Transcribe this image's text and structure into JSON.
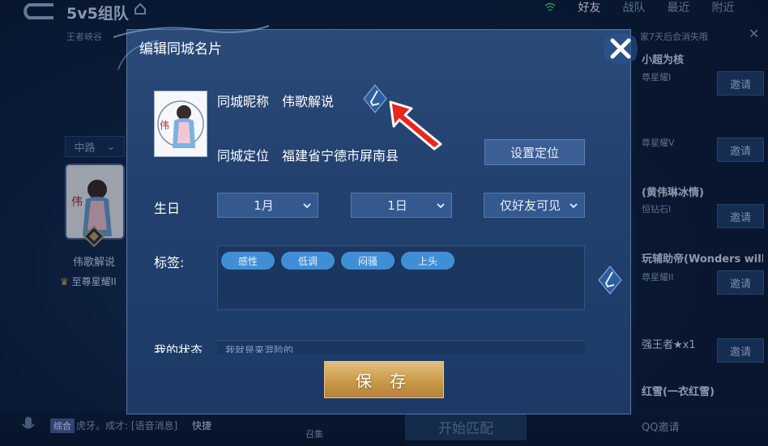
{
  "lobby": {
    "title": "5v5组队",
    "subtitle": "王者峡谷",
    "tabs": [
      "好友",
      "战队",
      "最近",
      "附近"
    ],
    "active_tab": "好友",
    "side_hint": "家7天后会消失哦",
    "friends": [
      {
        "name": "小超为核",
        "rank": "尊星耀I",
        "invite": "邀请"
      },
      {
        "name": "",
        "rank": "尊星耀V",
        "invite": "邀请"
      },
      {
        "name": "(黄伟琳冰情)",
        "rank": "恒钻石I",
        "invite": "邀请"
      },
      {
        "name": "玩辅助帝(Wonders will",
        "rank": "尊星耀II",
        "invite": "邀请"
      },
      {
        "name": "强王者★x1",
        "rank": "",
        "invite": "邀请"
      },
      {
        "name": "红雪(一衣红雪)",
        "rank": "",
        "invite": ""
      }
    ],
    "lane": "中路",
    "hero_name": "伟歌解说",
    "hero_rank": "至尊星耀II",
    "chat_tag": "综合",
    "chat_text": "虎牙。成才: [语音消息]",
    "quick": "快捷",
    "recruit": "召集",
    "start_match": "开始匹配",
    "qq_invite": "QQ邀请"
  },
  "modal": {
    "title": "编辑同城名片",
    "nickname_label": "同城昵称",
    "nickname_value": "伟歌解说",
    "location_label": "同城定位",
    "location_value": "福建省宁德市屏南县",
    "set_location_button": "设置定位",
    "birthday_label": "生日",
    "month": "1月",
    "day": "1日",
    "visibility": "仅好友可见",
    "tags_label": "标签:",
    "tags": [
      "感性",
      "低调",
      "闷骚",
      "上头"
    ],
    "status_label": "我的状态",
    "status_text": "我就是来混险的",
    "save_button": "保 存"
  },
  "colors": {
    "modal_bg": "#22416e",
    "tag_bg": "#3f8fd6",
    "save_gold": "#c99a4a",
    "arrow_red": "#e8261c"
  }
}
